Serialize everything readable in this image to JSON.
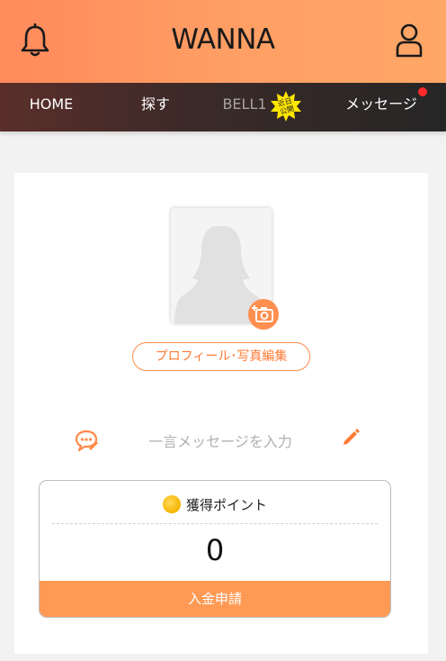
{
  "header": {
    "logo": "WANNA",
    "bell_icon": "bell-icon",
    "user_icon": "user-icon",
    "gradient": [
      "#ff8a5c",
      "#ffa767"
    ]
  },
  "nav": {
    "items": [
      {
        "label": "HOME"
      },
      {
        "label": "探す"
      },
      {
        "label": "BELL1",
        "badge": "近日公開"
      },
      {
        "label": "メッセージ",
        "has_notification": true
      }
    ]
  },
  "profile": {
    "avatar_icon": "avatar-silhouette-icon",
    "camera_icon": "camera-plus-icon",
    "edit_label": "プロフィール･写真編集"
  },
  "hitokoto": {
    "icon": "speech-bubble-icon",
    "placeholder": "一言メッセージを入力",
    "edit_icon": "pencil-icon"
  },
  "points": {
    "coin_icon": "coin-icon",
    "title": "獲得ポイント",
    "value": "0",
    "deposit_label": "入金申請"
  },
  "colors": {
    "accent": "#ff8a4a",
    "nav_bg": "#3a2a28",
    "notification": "#ff2a2a"
  }
}
